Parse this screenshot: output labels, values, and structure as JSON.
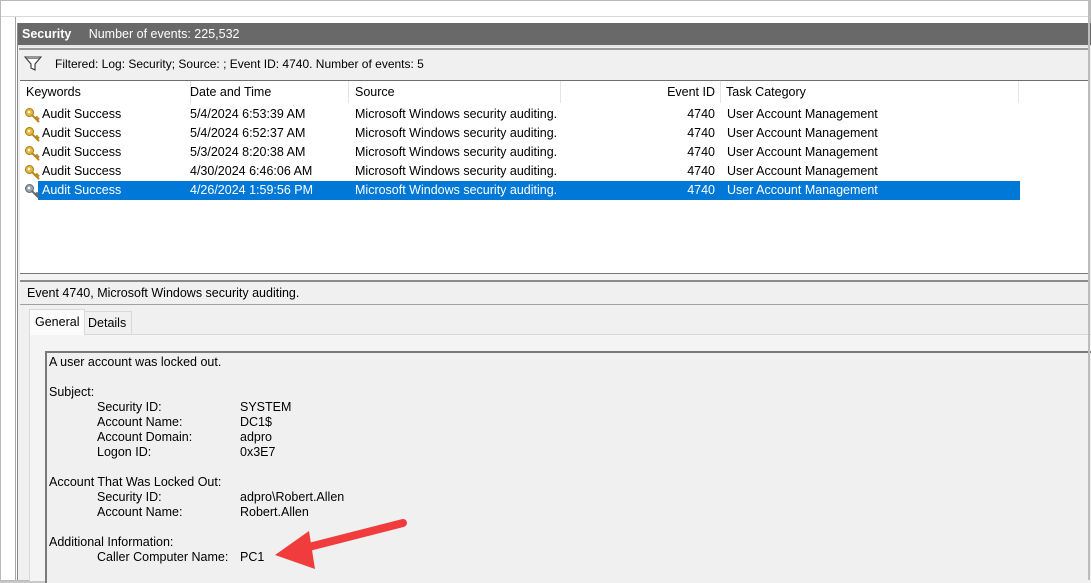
{
  "log_header": {
    "log_name": "Security",
    "event_count": "Number of events: 225,532"
  },
  "filter": {
    "icon": "funnel-icon",
    "text": "Filtered: Log: Security; Source: ; Event ID: 4740. Number of events: 5"
  },
  "grid": {
    "columns": [
      "Keywords",
      "Date and Time",
      "Source",
      "Event ID",
      "Task Category"
    ],
    "rows": [
      {
        "keywords": "Audit Success",
        "date_time": "5/4/2024 6:53:39 AM",
        "source": "Microsoft Windows security auditing.",
        "event_id": "4740",
        "task_category": "User Account Management",
        "icon": "key-icon",
        "selected": false
      },
      {
        "keywords": "Audit Success",
        "date_time": "5/4/2024 6:52:37 AM",
        "source": "Microsoft Windows security auditing.",
        "event_id": "4740",
        "task_category": "User Account Management",
        "icon": "key-icon",
        "selected": false
      },
      {
        "keywords": "Audit Success",
        "date_time": "5/3/2024 8:20:38 AM",
        "source": "Microsoft Windows security auditing.",
        "event_id": "4740",
        "task_category": "User Account Management",
        "icon": "key-icon",
        "selected": false
      },
      {
        "keywords": "Audit Success",
        "date_time": "4/30/2024 6:46:06 AM",
        "source": "Microsoft Windows security auditing.",
        "event_id": "4740",
        "task_category": "User Account Management",
        "icon": "key-icon",
        "selected": false
      },
      {
        "keywords": "Audit Success",
        "date_time": "4/26/2024 1:59:56 PM",
        "source": "Microsoft Windows security auditing.",
        "event_id": "4740",
        "task_category": "User Account Management",
        "icon": "key-icon",
        "selected": true
      }
    ]
  },
  "detail": {
    "header": "Event 4740, Microsoft Windows security auditing.",
    "tabs": [
      {
        "label": "General",
        "active": true
      },
      {
        "label": "Details",
        "active": false
      }
    ],
    "message": {
      "title": "A user account was locked out.",
      "subject_heading": "Subject:",
      "subject": [
        {
          "label": "Security ID:",
          "value": "SYSTEM"
        },
        {
          "label": "Account Name:",
          "value": "DC1$"
        },
        {
          "label": "Account Domain:",
          "value": "adpro"
        },
        {
          "label": "Logon ID:",
          "value": "0x3E7"
        }
      ],
      "locked_heading": "Account That Was Locked Out:",
      "locked": [
        {
          "label": "Security ID:",
          "value": "adpro\\Robert.Allen"
        },
        {
          "label": "Account Name:",
          "value": "Robert.Allen"
        }
      ],
      "additional_heading": "Additional Information:",
      "additional": [
        {
          "label": "Caller Computer Name:",
          "value": "PC1"
        }
      ]
    }
  },
  "annotation": {
    "icon": "red-arrow-annotation",
    "color": "#f03c3c"
  },
  "colors": {
    "selection": "#0078d7",
    "title_bar": "#696969"
  }
}
